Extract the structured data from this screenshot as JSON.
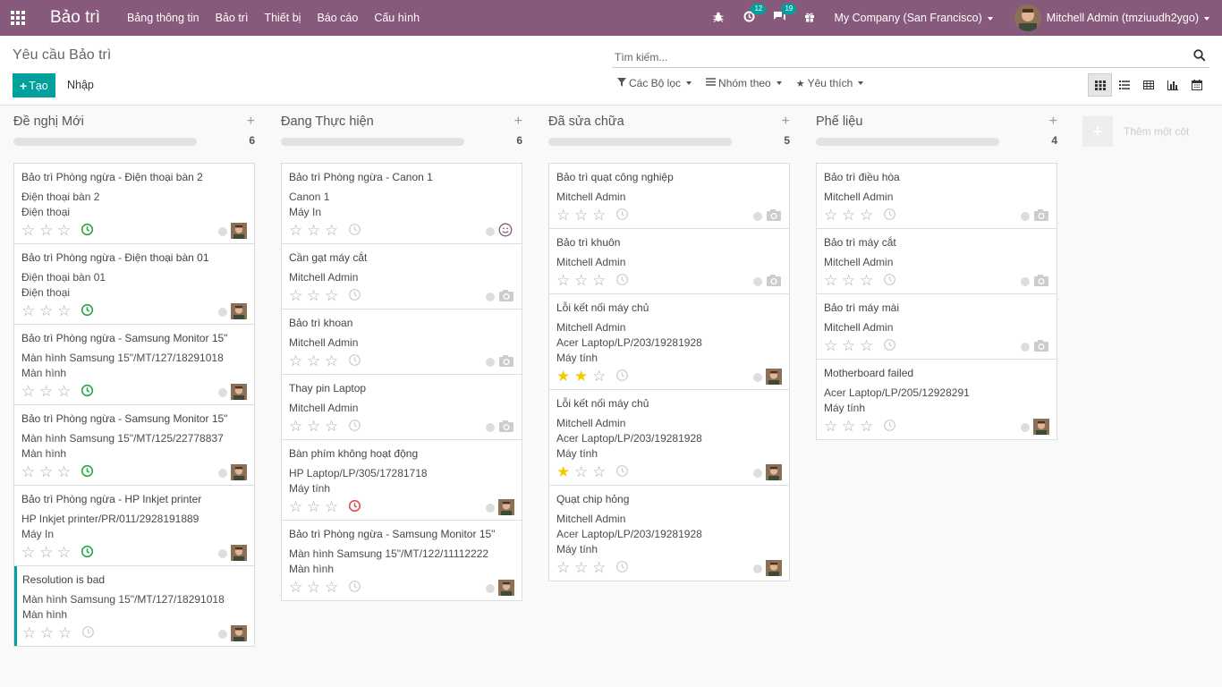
{
  "app": {
    "title": "Bảo trì"
  },
  "menu": [
    "Bảng thông tin",
    "Bảo trì",
    "Thiết bị",
    "Báo cáo",
    "Cấu hình"
  ],
  "systray": {
    "activity_count": "12",
    "message_count": "19",
    "company": "My Company (San Francisco)",
    "user": "Mitchell Admin (tmziuudh2ygo)"
  },
  "control": {
    "breadcrumb": "Yêu cầu Bảo trì",
    "create_label": "Tạo",
    "import_label": "Nhập",
    "search_placeholder": "Tìm kiếm...",
    "filters_label": "Các Bộ lọc",
    "groupby_label": "Nhóm theo",
    "favorites_label": "Yêu thích"
  },
  "views": [
    "kanban",
    "list",
    "pivot",
    "graph",
    "calendar"
  ],
  "add_column_label": "Thêm một cột",
  "columns": [
    {
      "title": "Đề nghị Mới",
      "count": "6",
      "cards": [
        {
          "title": "Bảo trì Phòng ngừa - Điện thoại bàn 2",
          "lines": [
            "Điện thoại bàn 2",
            "Điện thoại"
          ],
          "stars": 0,
          "activity": "clock-ok",
          "avatar": true
        },
        {
          "title": "Bảo trì Phòng ngừa - Điện thoại bàn 01",
          "lines": [
            "Điện thoại bàn 01",
            "Điện thoại"
          ],
          "stars": 0,
          "activity": "clock-ok",
          "avatar": true
        },
        {
          "title": "Bảo trì Phòng ngừa - Samsung Monitor 15\"",
          "lines": [
            "Màn hình Samsung 15\"/MT/127/18291018",
            "Màn hình"
          ],
          "stars": 0,
          "activity": "clock-ok",
          "avatar": true
        },
        {
          "title": "Bảo trì Phòng ngừa - Samsung Monitor 15\"",
          "lines": [
            "Màn hình Samsung 15\"/MT/125/22778837",
            "Màn hình"
          ],
          "stars": 0,
          "activity": "clock-ok",
          "avatar": true
        },
        {
          "title": "Bảo trì Phòng ngừa - HP Inkjet printer",
          "lines": [
            "HP Inkjet printer/PR/011/2928191889",
            "Máy In"
          ],
          "stars": 0,
          "activity": "clock-ok",
          "avatar": true
        },
        {
          "title": "Resolution is bad",
          "lines": [
            "Màn hình Samsung 15\"/MT/127/18291018",
            "Màn hình"
          ],
          "stars": 0,
          "activity": "clock",
          "avatar": true,
          "accent": true
        }
      ]
    },
    {
      "title": "Đang Thực hiện",
      "count": "6",
      "cards": [
        {
          "title": "Bảo trì Phòng ngừa - Canon 1",
          "lines": [
            "Canon 1",
            "Máy In"
          ],
          "stars": 0,
          "activity": "clock",
          "avatar": false,
          "unassigned": "smiley"
        },
        {
          "title": "Cần gạt máy cắt",
          "lines": [
            "Mitchell Admin"
          ],
          "stars": 0,
          "activity": "clock",
          "avatar": false
        },
        {
          "title": "Bảo trì khoan",
          "lines": [
            "Mitchell Admin"
          ],
          "stars": 0,
          "activity": "clock",
          "avatar": false
        },
        {
          "title": "Thay pin Laptop",
          "lines": [
            "Mitchell Admin"
          ],
          "stars": 0,
          "activity": "clock",
          "avatar": false
        },
        {
          "title": "Bàn phím không hoạt động",
          "lines": [
            "HP Laptop/LP/305/17281718",
            "Máy tính"
          ],
          "stars": 0,
          "activity": "clock-late",
          "avatar": true
        },
        {
          "title": "Bảo trì Phòng ngừa - Samsung Monitor 15\"",
          "lines": [
            "Màn hình Samsung 15\"/MT/122/11112222",
            "Màn hình"
          ],
          "stars": 0,
          "activity": "clock",
          "avatar": true
        }
      ]
    },
    {
      "title": "Đã sửa chữa",
      "count": "5",
      "cards": [
        {
          "title": "Bảo trì quạt công nghiệp",
          "lines": [
            "Mitchell Admin"
          ],
          "stars": 0,
          "activity": "clock",
          "avatar": false
        },
        {
          "title": "Bảo trì khuôn",
          "lines": [
            "Mitchell Admin"
          ],
          "stars": 0,
          "activity": "clock",
          "avatar": false
        },
        {
          "title": "Lỗi kết nối máy chủ",
          "lines": [
            "Mitchell Admin",
            "Acer Laptop/LP/203/19281928",
            "Máy tính"
          ],
          "stars": 2,
          "activity": "clock",
          "avatar": true
        },
        {
          "title": "Lỗi kết nối máy chủ",
          "lines": [
            "Mitchell Admin",
            "Acer Laptop/LP/203/19281928",
            "Máy tính"
          ],
          "stars": 1,
          "activity": "clock",
          "avatar": true
        },
        {
          "title": "Quạt chip hỏng",
          "lines": [
            "Mitchell Admin",
            "Acer Laptop/LP/203/19281928",
            "Máy tính"
          ],
          "stars": 0,
          "activity": "clock",
          "avatar": true
        }
      ]
    },
    {
      "title": "Phế liệu",
      "count": "4",
      "cards": [
        {
          "title": "Bảo trì điều hòa",
          "lines": [
            "Mitchell Admin"
          ],
          "stars": 0,
          "activity": "clock",
          "avatar": false
        },
        {
          "title": "Bảo trì máy cắt",
          "lines": [
            "Mitchell Admin"
          ],
          "stars": 0,
          "activity": "clock",
          "avatar": false
        },
        {
          "title": "Bảo trì máy mài",
          "lines": [
            "Mitchell Admin"
          ],
          "stars": 0,
          "activity": "clock",
          "avatar": false
        },
        {
          "title": "Motherboard failed",
          "lines": [
            "Acer Laptop/LP/205/12928291",
            "Máy tính"
          ],
          "stars": 0,
          "activity": "clock",
          "avatar": true
        }
      ]
    }
  ]
}
